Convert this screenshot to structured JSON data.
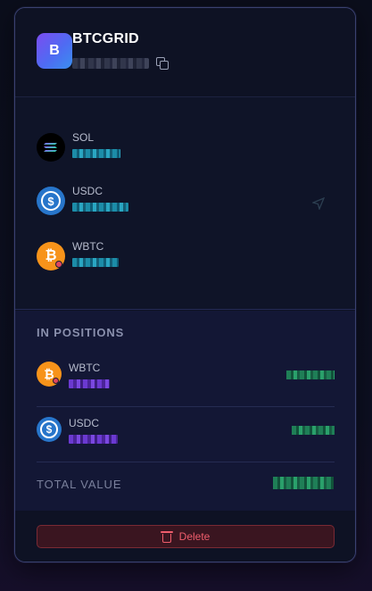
{
  "wallet": {
    "avatar_letter": "B",
    "name": "BTCGRID",
    "address_masked": true
  },
  "assets": [
    {
      "symbol": "SOL",
      "icon": "solana-icon"
    },
    {
      "symbol": "USDC",
      "icon": "usdc-icon"
    },
    {
      "symbol": "WBTC",
      "icon": "wbtc-icon"
    }
  ],
  "positions": {
    "title": "IN POSITIONS",
    "items": [
      {
        "symbol": "WBTC",
        "icon": "wbtc-icon"
      },
      {
        "symbol": "USDC",
        "icon": "usdc-icon"
      }
    ],
    "total_label": "TOTAL VALUE"
  },
  "actions": {
    "delete_label": "Delete"
  },
  "colors": {
    "accent": "#5b6cf2",
    "danger": "#ef5d6c",
    "card_border": "#3a4170"
  }
}
